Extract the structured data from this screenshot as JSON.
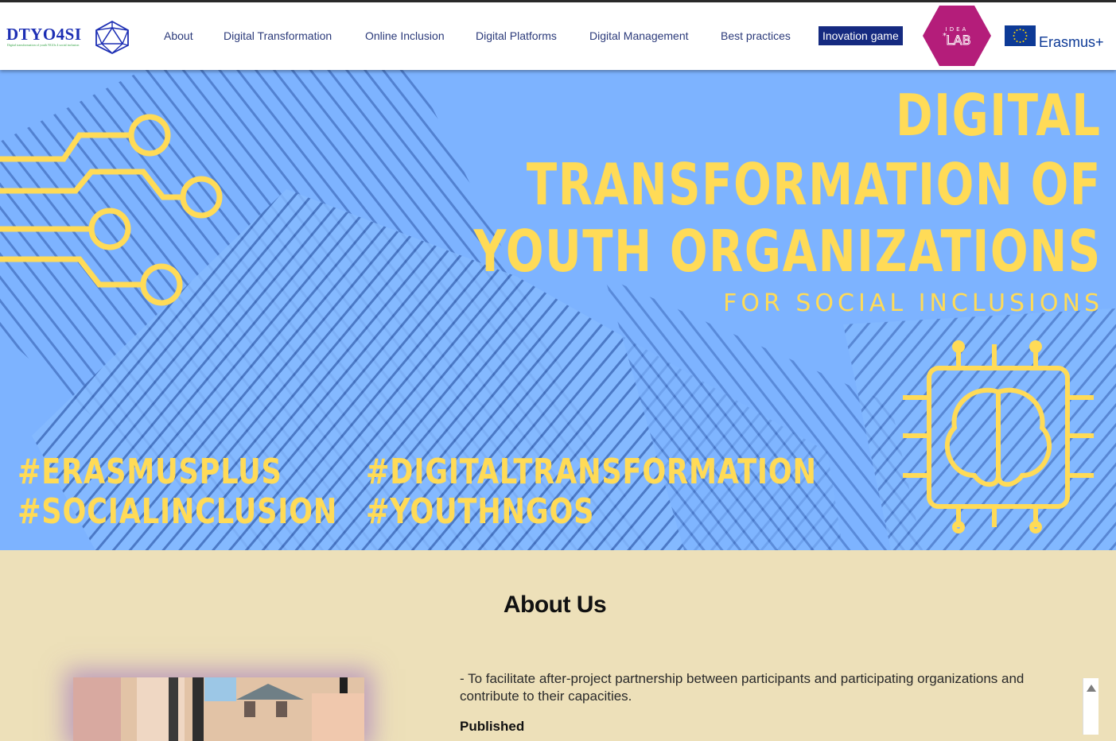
{
  "logo": {
    "name": "DTYO4SI",
    "tagline": "Digital transformation of youth NGOs 4 social inclusion"
  },
  "nav": {
    "items": [
      "About",
      "Digital Transformation",
      "Online Inclusion",
      "Digital Platforms",
      "Digital Management",
      "Best practices"
    ],
    "game_label": "Inovation game"
  },
  "partners": {
    "idealab_top": "IDEA",
    "idealab_bottom": "LAB",
    "erasmus": "Erasmus+"
  },
  "hero": {
    "line1": "DIGITAL",
    "line2": "TRANSFORMATION OF",
    "line3": "YOUTH ORGANIZATIONS",
    "line4": "FOR SOCIAL INCLUSIONS",
    "hashtags": [
      "#ERASMUSPLUS",
      "#SOCIALINCLUSION",
      "#DIGITALTRANSFORMATION",
      "#YOUTHNGOS"
    ]
  },
  "about": {
    "title": "About Us",
    "text": "- To facilitate after-project partnership between participants and participating organizations and contribute to their capacities.",
    "published": "Published"
  },
  "colors": {
    "accent": "#152a80",
    "hero_bg": "#7db3ff",
    "hero_text": "#ffdb57",
    "section_bg": "#ede0b9"
  }
}
